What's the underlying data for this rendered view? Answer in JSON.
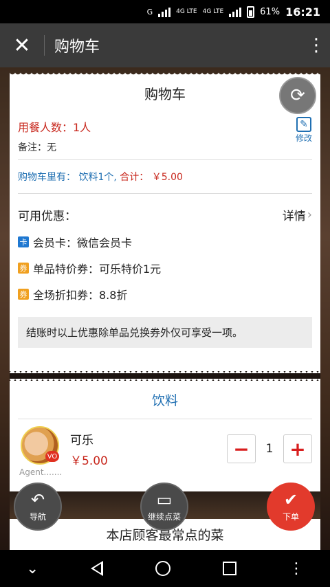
{
  "status": {
    "network_1": "G",
    "network_2": "4G LTE",
    "network_3": "4G LTE",
    "battery": "61%",
    "time": "16:21"
  },
  "appbar": {
    "title": "购物车"
  },
  "receipt": {
    "title": "购物车",
    "diners": "用餐人数：1人",
    "note": "备注：无",
    "edit_label": "修改",
    "cart_prefix": "购物车里有：",
    "cart_items": "饮料1个,",
    "cart_total_label": "合计：",
    "cart_total": "￥5.00",
    "promo_title": "可用优惠：",
    "promo_detail": "详情",
    "promos": [
      {
        "badge": "卡",
        "color": "blue",
        "text": "会员卡：微信会员卡"
      },
      {
        "badge": "券",
        "color": "orange",
        "text": "单品特价券：可乐特价1元"
      },
      {
        "badge": "券",
        "color": "orange",
        "text": "全场折扣券：8.8折"
      }
    ],
    "notice": "结账时以上优惠除单品兑换券外仅可享受一项。"
  },
  "category": {
    "title": "饮料"
  },
  "product": {
    "name": "可乐",
    "price": "￥5.00",
    "qty": "1",
    "agent": "Agent.......",
    "badge": "VO"
  },
  "popular_title": "本店顾客最常点的菜",
  "fabs": {
    "nav": "导航",
    "menu": "继续点菜",
    "order": "下单"
  }
}
